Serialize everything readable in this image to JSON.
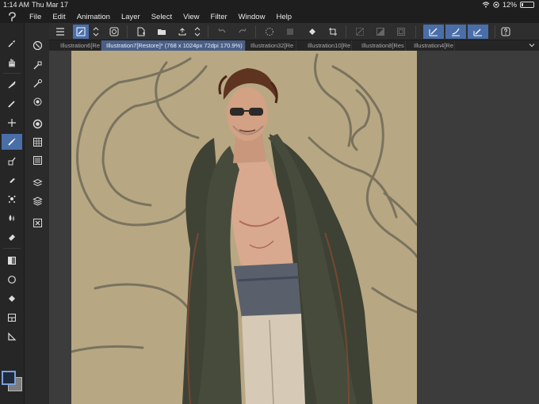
{
  "status": {
    "time": "1:14 AM",
    "date": "Thu Mar 17",
    "battery": "12%",
    "battery_level": 0.12
  },
  "menu": [
    "File",
    "Edit",
    "Animation",
    "Layer",
    "Select",
    "View",
    "Filter",
    "Window",
    "Help"
  ],
  "tabs": [
    {
      "label": "Illustration6[Re",
      "active": false
    },
    {
      "label": "Illustration7[Restore]* (768 x 1024px 72dpi 170.9%)",
      "active": true
    },
    {
      "label": "Illustration32[Re",
      "active": false
    },
    {
      "label": "Illustration10[Re",
      "active": false
    },
    {
      "label": "Illustration8[Res",
      "active": false
    },
    {
      "label": "Illustration4[Re",
      "active": false
    }
  ],
  "colors": {
    "accent": "#4a6ea8",
    "canvas": "#b8a783",
    "main_color": "#1f2a3a",
    "sub_color": "#7d7d7d"
  }
}
